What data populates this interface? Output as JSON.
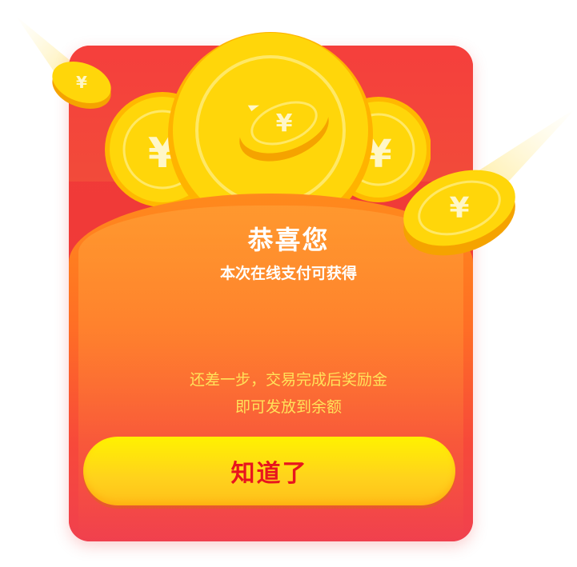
{
  "dialog": {
    "title": "恭喜您",
    "subtitle": "本次在线支付可获得",
    "message_line1": "还差一步，交易完成后奖励金",
    "message_line2": "即可发放到余额",
    "button_label": "知道了"
  },
  "decor": {
    "coin_symbol": "¥",
    "colors": {
      "envelope": "#f23b36",
      "pocket": "#ff8a1c",
      "coin": "#ffd20a",
      "button": "#ffe100",
      "button_text": "#e8151e",
      "message_text": "#ffe25a"
    }
  }
}
